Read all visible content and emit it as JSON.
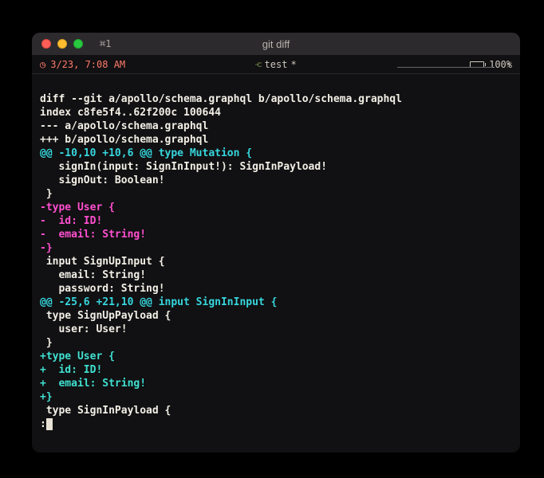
{
  "window": {
    "title": "git diff",
    "tab_label": "⌘1"
  },
  "status": {
    "time_icon": "◷",
    "time": "3/23, 7:08 AM",
    "branch_icon": "⑂",
    "branch": "test",
    "branch_dirty": "*",
    "battery_pct": "100%",
    "bolt": "⚡"
  },
  "diff": {
    "cmd": "diff --git a/apollo/schema.graphql b/apollo/schema.graphql",
    "index": "index c8fe5f4..62f200c 100644",
    "from": "--- a/apollo/schema.graphql",
    "to": "+++ b/apollo/schema.graphql",
    "hunk1": "@@ -10,10 +10,6 @@ type Mutation {",
    "c1": "   signIn(input: SignInInput!): SignInPayload!",
    "c2": "   signOut: Boolean!",
    "c3": " }",
    "d1": "-type User {",
    "d2": "-  id: ID!",
    "d3": "-  email: String!",
    "d4": "-}",
    "c4": " input SignUpInput {",
    "c5": "   email: String!",
    "c6": "   password: String!",
    "hunk2": "@@ -25,6 +21,10 @@ input SignInInput {",
    "c7": " type SignUpPayload {",
    "c8": "   user: User!",
    "c9": " }",
    "a1": "+type User {",
    "a2": "+  id: ID!",
    "a3": "+  email: String!",
    "a4": "+}",
    "c10": " type SignInPayload {",
    "prompt": ":"
  }
}
